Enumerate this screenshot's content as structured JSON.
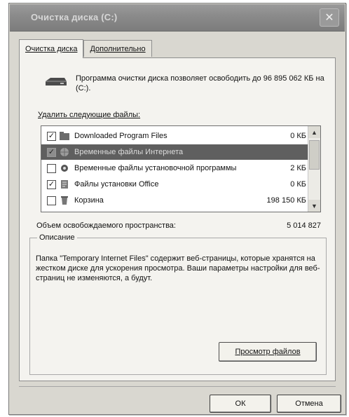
{
  "window": {
    "title": "Очистка диска (C:)",
    "close_glyph": "✕"
  },
  "tabs": [
    {
      "label": "Очистка диска",
      "active": true
    },
    {
      "label": "Дополнительно",
      "active": false
    }
  ],
  "info": {
    "text": "Программа очистки диска позволяет освободить до 96 895 062 КБ на (C:)."
  },
  "files_section": {
    "label": "Удалить следующие файлы:",
    "items": [
      {
        "label": "Downloaded Program Files",
        "size": "0 КБ",
        "checked": true,
        "selected": false,
        "icon": "folder-icon"
      },
      {
        "label": "Временные файлы Интернета",
        "size": "",
        "checked": true,
        "selected": true,
        "icon": "globe-icon"
      },
      {
        "label": "Временные файлы установочной программы",
        "size": "2 КБ",
        "checked": false,
        "selected": false,
        "icon": "gear-icon"
      },
      {
        "label": "Файлы установки Office",
        "size": "0 КБ",
        "checked": true,
        "selected": false,
        "icon": "office-icon"
      },
      {
        "label": "Корзина",
        "size": "198 150 КБ",
        "checked": false,
        "selected": false,
        "icon": "recycle-bin-icon"
      }
    ]
  },
  "total": {
    "label": "Объем освобождаемого пространства:",
    "value": "5 014 827"
  },
  "description": {
    "legend": "Описание",
    "text": "Папка \"Temporary Internet Files\" содержит веб-страницы, которые хранятся на жестком диске для ускорения просмотра. Ваши параметры настройки для веб-страниц не изменяются, а будут."
  },
  "buttons": {
    "view_files": "Просмотр файлов",
    "ok": "ОК",
    "cancel": "Отмена"
  }
}
